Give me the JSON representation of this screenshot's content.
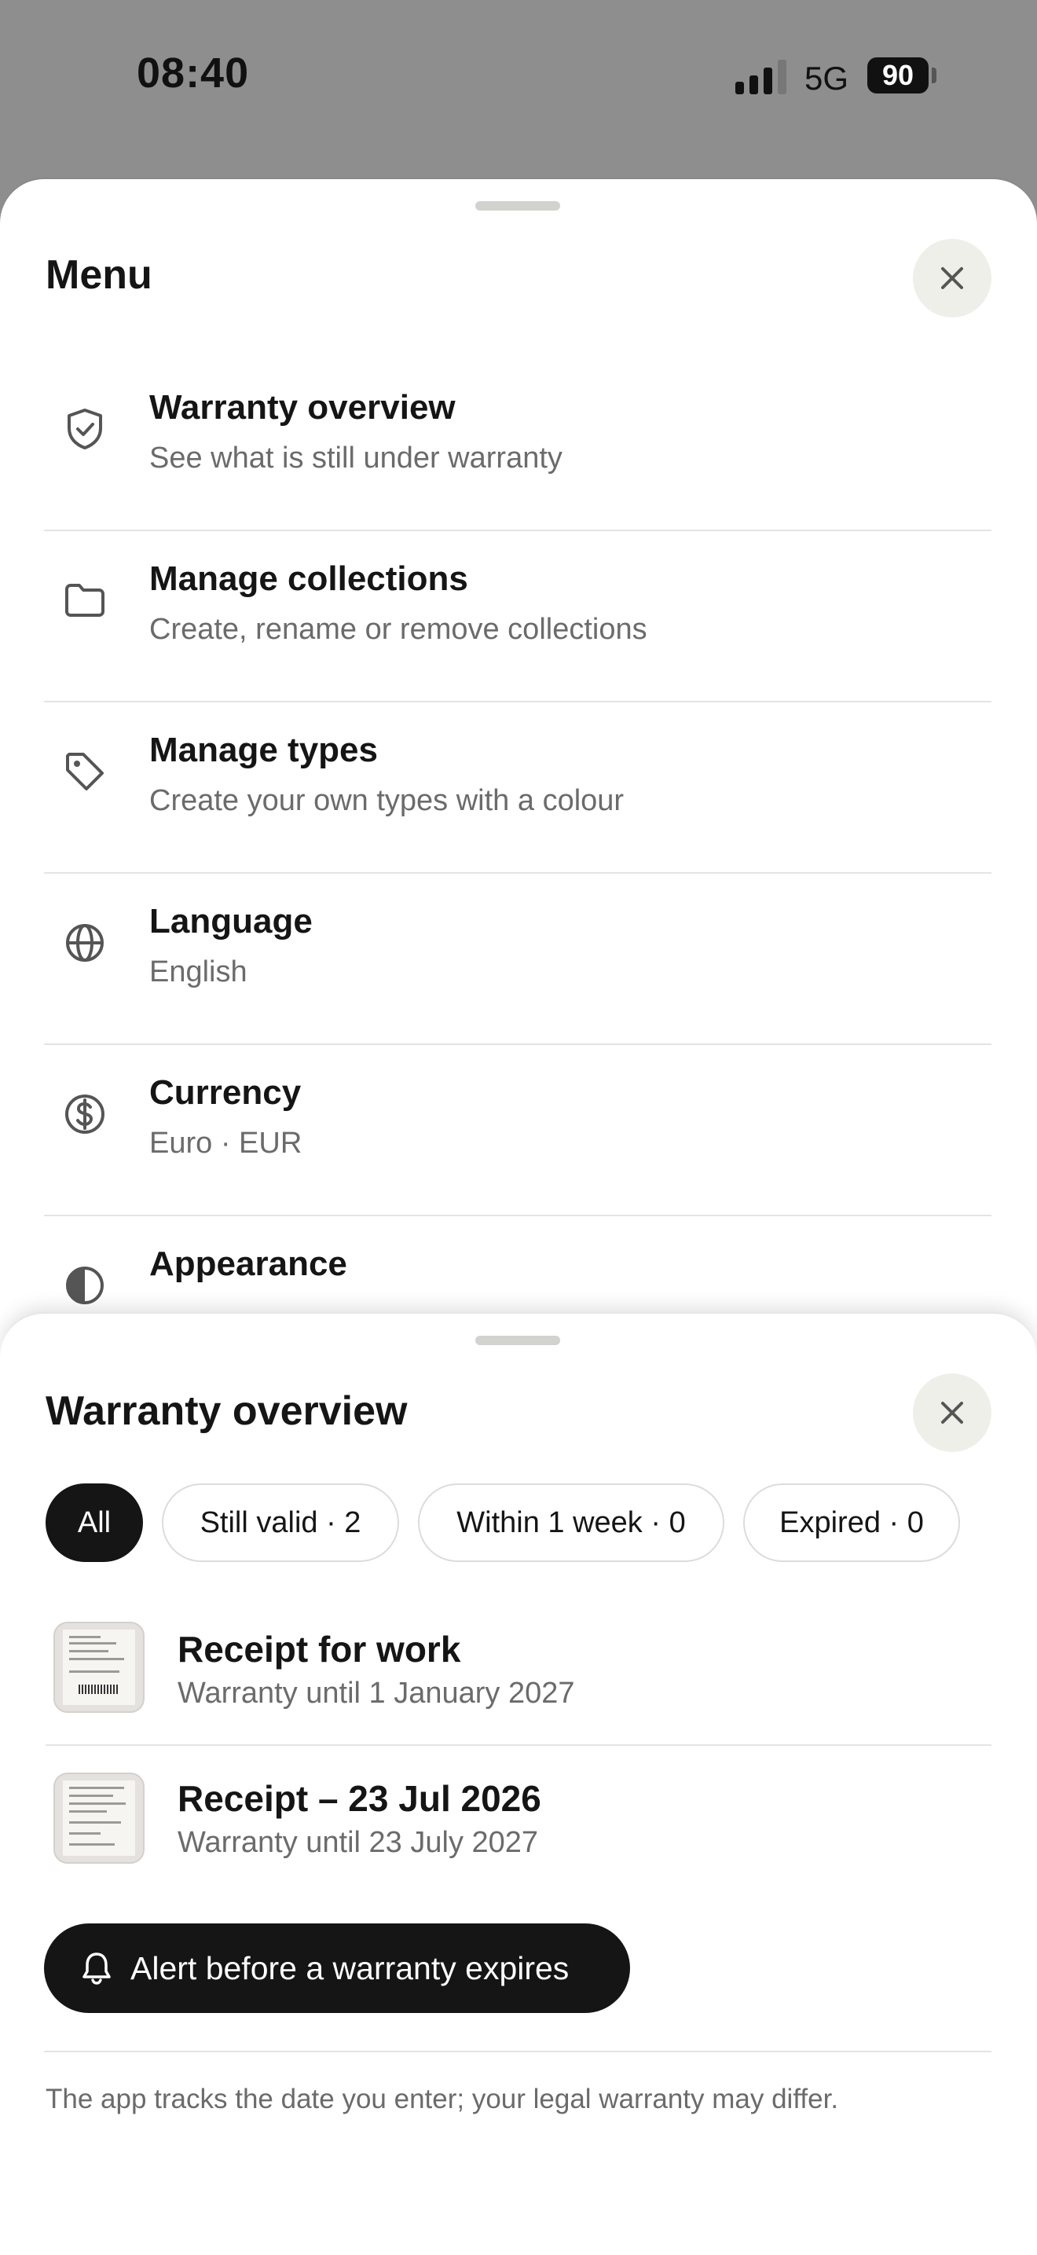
{
  "status_bar": {
    "time": "08:40",
    "network": "5G",
    "battery": "90"
  },
  "menu": {
    "title": "Menu",
    "items": [
      {
        "icon": "shield-check-icon",
        "title": "Warranty overview",
        "subtitle": "See what is still under warranty"
      },
      {
        "icon": "folder-icon",
        "title": "Manage collections",
        "subtitle": "Create, rename or remove collections"
      },
      {
        "icon": "tag-icon",
        "title": "Manage types",
        "subtitle": "Create your own types with a colour"
      },
      {
        "icon": "globe-icon",
        "title": "Language",
        "subtitle": "English"
      },
      {
        "icon": "dollar-circle-icon",
        "title": "Currency",
        "subtitle": "Euro · EUR"
      },
      {
        "icon": "half-circle-icon",
        "title": "Appearance",
        "subtitle": ""
      }
    ]
  },
  "warranty": {
    "title": "Warranty overview",
    "filters": [
      {
        "label": "All",
        "active": true
      },
      {
        "label": "Still valid · 2",
        "active": false
      },
      {
        "label": "Within 1 week · 0",
        "active": false
      },
      {
        "label": "Expired · 0",
        "active": false
      }
    ],
    "receipts": [
      {
        "title": "Receipt for work",
        "subtitle": "Warranty until 1 January 2027"
      },
      {
        "title": "Receipt – 23 Jul 2026",
        "subtitle": "Warranty until 23 July 2027"
      }
    ],
    "alert_button": "Alert before a warranty expires",
    "alert_icon": "bell-icon",
    "note": "The app tracks the date you enter; your legal warranty may differ."
  },
  "colors": {
    "accent": "#151515",
    "muted_text": "#6b6b6b",
    "close_bg": "#efefea",
    "backdrop": "#8e8e8e"
  }
}
